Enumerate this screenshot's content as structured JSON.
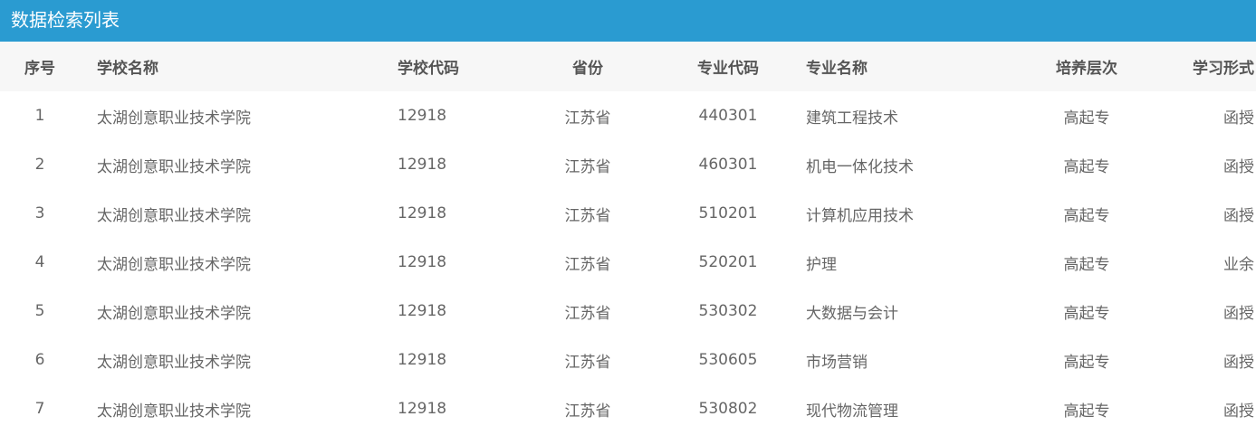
{
  "panel": {
    "title": "数据检索列表"
  },
  "table": {
    "headers": {
      "index": "序号",
      "school_name": "学校名称",
      "school_code": "学校代码",
      "province": "省份",
      "major_code": "专业代码",
      "major_name": "专业名称",
      "level": "培养层次",
      "study_mode": "学习形式"
    },
    "rows": [
      {
        "index": "1",
        "school_name": "太湖创意职业技术学院",
        "school_code": "12918",
        "province": "江苏省",
        "major_code": "440301",
        "major_name": "建筑工程技术",
        "level": "高起专",
        "study_mode": "函授"
      },
      {
        "index": "2",
        "school_name": "太湖创意职业技术学院",
        "school_code": "12918",
        "province": "江苏省",
        "major_code": "460301",
        "major_name": "机电一体化技术",
        "level": "高起专",
        "study_mode": "函授"
      },
      {
        "index": "3",
        "school_name": "太湖创意职业技术学院",
        "school_code": "12918",
        "province": "江苏省",
        "major_code": "510201",
        "major_name": "计算机应用技术",
        "level": "高起专",
        "study_mode": "函授"
      },
      {
        "index": "4",
        "school_name": "太湖创意职业技术学院",
        "school_code": "12918",
        "province": "江苏省",
        "major_code": "520201",
        "major_name": "护理",
        "level": "高起专",
        "study_mode": "业余"
      },
      {
        "index": "5",
        "school_name": "太湖创意职业技术学院",
        "school_code": "12918",
        "province": "江苏省",
        "major_code": "530302",
        "major_name": "大数据与会计",
        "level": "高起专",
        "study_mode": "函授"
      },
      {
        "index": "6",
        "school_name": "太湖创意职业技术学院",
        "school_code": "12918",
        "province": "江苏省",
        "major_code": "530605",
        "major_name": "市场营销",
        "level": "高起专",
        "study_mode": "函授"
      },
      {
        "index": "7",
        "school_name": "太湖创意职业技术学院",
        "school_code": "12918",
        "province": "江苏省",
        "major_code": "530802",
        "major_name": "现代物流管理",
        "level": "高起专",
        "study_mode": "函授"
      }
    ]
  }
}
